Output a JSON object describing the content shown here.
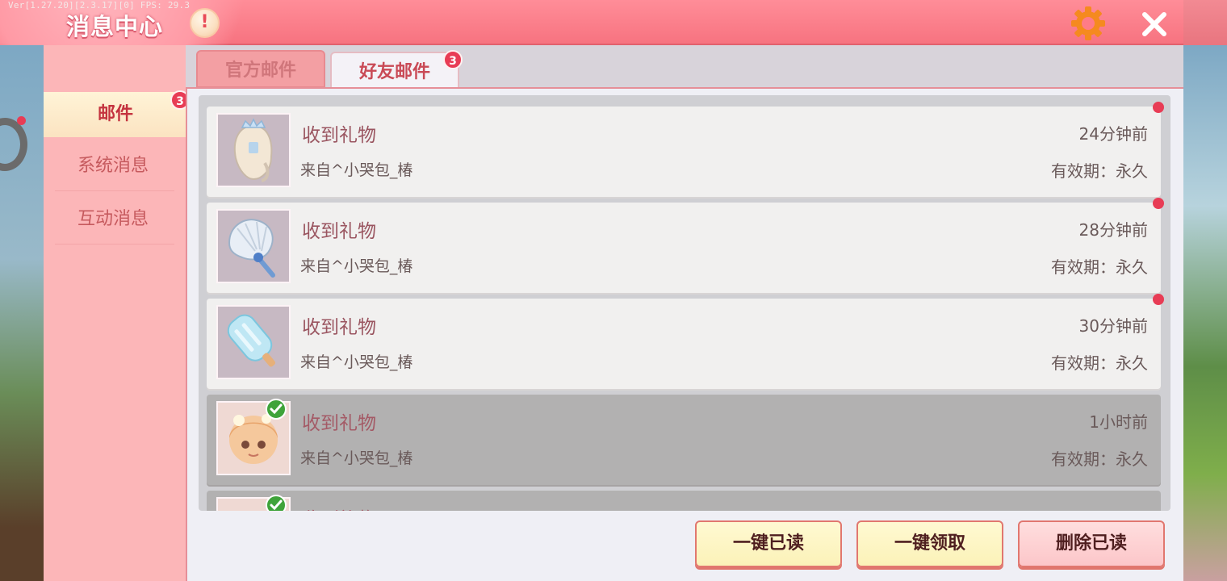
{
  "version_text": "Ver[1.27.20][2.3.17][0] FPS: 29.3",
  "header": {
    "title": "消息中心",
    "alert_glyph": "!",
    "settings_icon": "gear-icon",
    "close_icon": "close-icon"
  },
  "sidebar": {
    "items": [
      {
        "label": "邮件",
        "badge": "3",
        "active": true
      },
      {
        "label": "系统消息",
        "active": false
      },
      {
        "label": "互动消息",
        "active": false
      }
    ]
  },
  "tabs": [
    {
      "label": "官方邮件",
      "active": false
    },
    {
      "label": "好友邮件",
      "active": true,
      "badge": "3"
    }
  ],
  "mails": [
    {
      "title": "收到礼物",
      "from": "来自^小哭包_椿",
      "time": "24分钟前",
      "validity": "有效期：永久",
      "read": false,
      "item_icon": "hair-icon"
    },
    {
      "title": "收到礼物",
      "from": "来自^小哭包_椿",
      "time": "28分钟前",
      "validity": "有效期：永久",
      "read": false,
      "item_icon": "shell-fan-icon"
    },
    {
      "title": "收到礼物",
      "from": "来自^小哭包_椿",
      "time": "30分钟前",
      "validity": "有效期：永久",
      "read": false,
      "item_icon": "popsicle-icon"
    },
    {
      "title": "收到礼物",
      "from": "来自^小哭包_椿",
      "time": "1小时前",
      "validity": "有效期：永久",
      "read": true,
      "item_icon": "avatar-icon"
    },
    {
      "title": "收到礼物",
      "from": "",
      "time": "",
      "validity": "",
      "read": true,
      "item_icon": "avatar-icon"
    }
  ],
  "actions": {
    "mark_all_read": "一键已读",
    "claim_all": "一键领取",
    "delete_read": "删除已读"
  },
  "colors": {
    "header": "#f77380",
    "sidebar": "#fcb6b8",
    "badge": "#e83c55",
    "accent_text": "#c4333f"
  }
}
